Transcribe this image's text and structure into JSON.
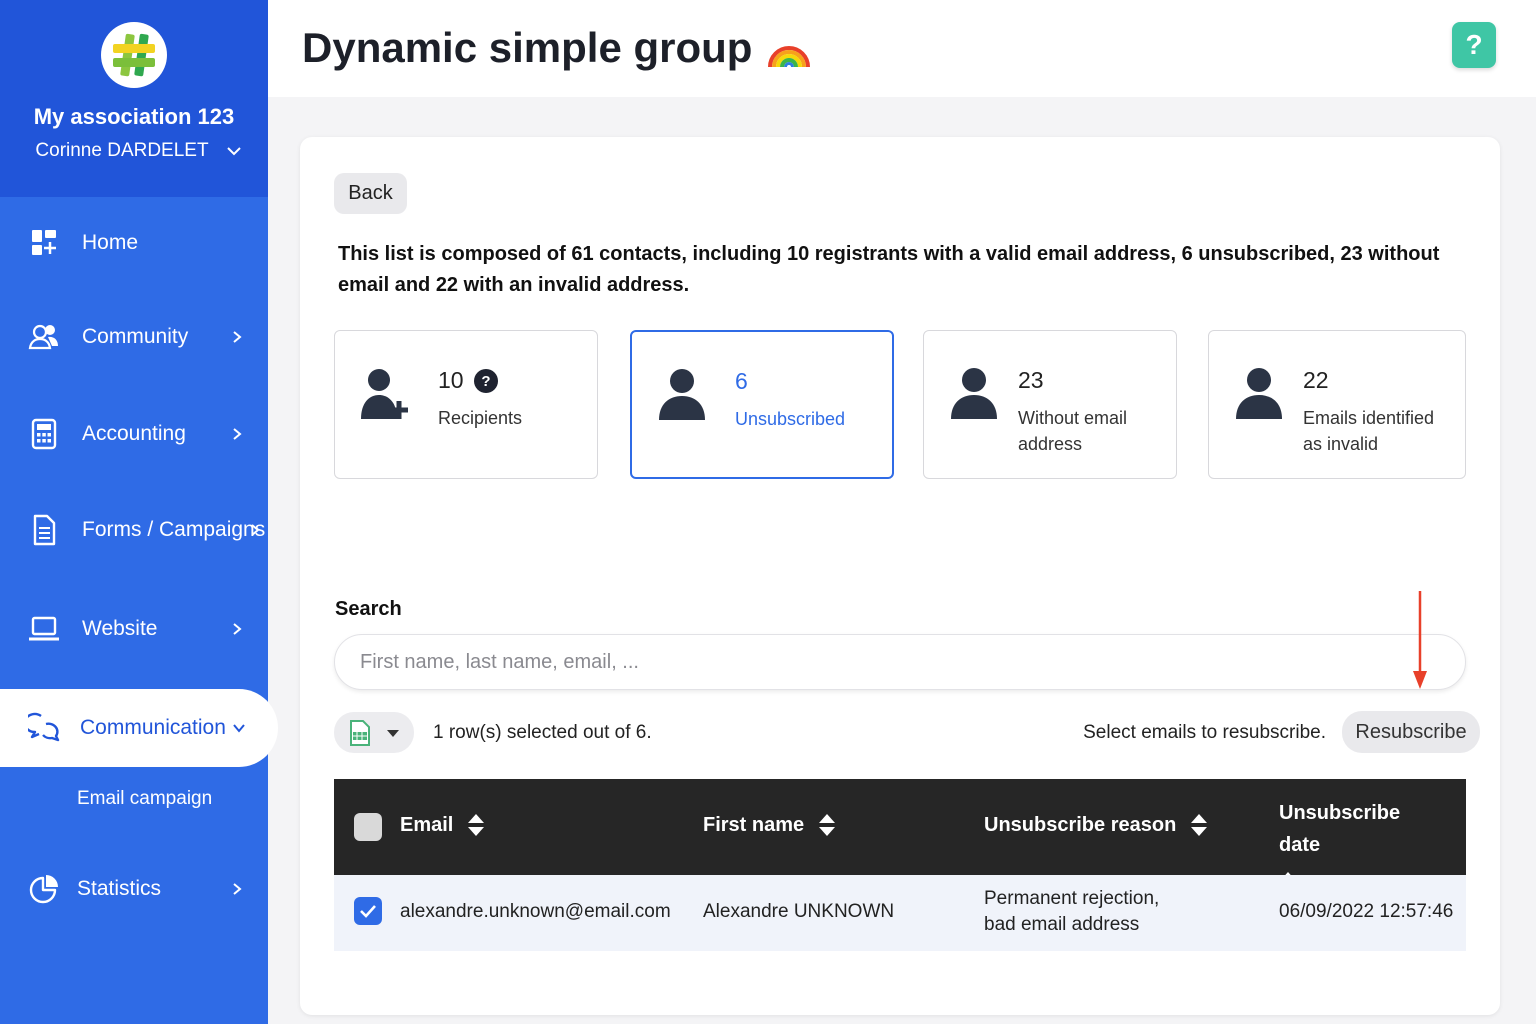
{
  "sidebar": {
    "org_name": "My association 123",
    "user_name": "Corinne DARDELET",
    "items": [
      {
        "label": "Home",
        "icon": "home-grid-icon"
      },
      {
        "label": "Community",
        "icon": "users-icon"
      },
      {
        "label": "Accounting",
        "icon": "calculator-icon"
      },
      {
        "label": "Forms / Campaigns",
        "icon": "document-icon"
      },
      {
        "label": "Website",
        "icon": "laptop-icon"
      },
      {
        "label": "Communication",
        "icon": "chat-icon"
      },
      {
        "label": "Statistics",
        "icon": "pie-chart-icon"
      }
    ],
    "sub_items": [
      {
        "label": "Email campaign"
      }
    ]
  },
  "header": {
    "title": "Dynamic simple group",
    "title_emoji": "🌈",
    "help_label": "?"
  },
  "main": {
    "back_label": "Back",
    "summary": "This list is composed of 61 contacts, including 10 registrants with a valid email address, 6 unsubscribed, 23 without email and 22 with an invalid address.",
    "stats": [
      {
        "value": "10",
        "caption": "Recipients",
        "has_help": true
      },
      {
        "value": "6",
        "caption": "Unsubscribed",
        "active": true
      },
      {
        "value": "23",
        "caption": "Without email address"
      },
      {
        "value": "22",
        "caption": "Emails identified as invalid"
      }
    ],
    "search": {
      "label": "Search",
      "placeholder": "First name, last name, email, ..."
    },
    "selection_text": "1 row(s) selected out of 6.",
    "resubscribe_hint": "Select emails to resubscribe.",
    "resubscribe_label": "Resubscribe"
  },
  "table": {
    "columns": [
      "Email",
      "First name",
      "Unsubscribe reason",
      "Unsubscribe date"
    ],
    "rows": [
      {
        "email": "alexandre.unknown@email.com",
        "first_name": "Alexandre UNKNOWN",
        "reason": "Permanent rejection, bad email address",
        "date": "06/09/2022 12:57:46",
        "checked": true
      }
    ]
  },
  "colors": {
    "sidebar": "#2f6be6",
    "sidebar_head": "#2155d9",
    "accent": "#2f6be6",
    "help": "#3fc6a5",
    "table_header": "#262626",
    "arrow": "#e8402a"
  }
}
